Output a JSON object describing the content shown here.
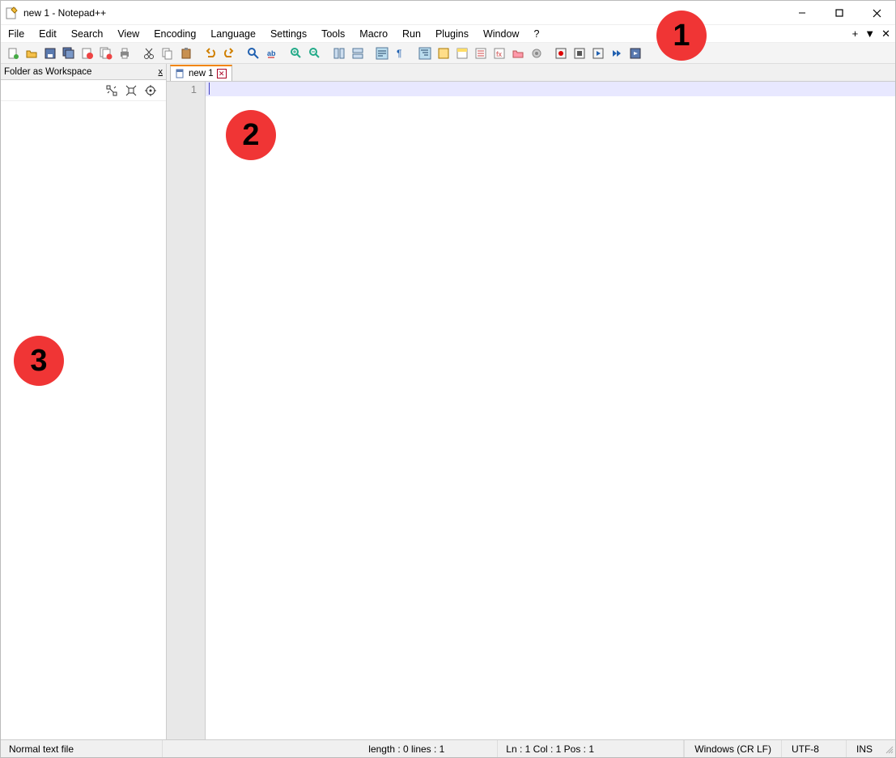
{
  "title": "new 1 - Notepad++",
  "menu": [
    "File",
    "Edit",
    "Search",
    "View",
    "Encoding",
    "Language",
    "Settings",
    "Tools",
    "Macro",
    "Run",
    "Plugins",
    "Window",
    "?"
  ],
  "toolbar_names": [
    "new",
    "open",
    "save",
    "save-all",
    "close",
    "close-all",
    "print",
    "",
    "cut",
    "copy",
    "paste",
    "",
    "undo",
    "redo",
    "",
    "find",
    "replace",
    "",
    "zoom-in",
    "zoom-out",
    "",
    "sync-v",
    "sync-h",
    "",
    "word-wrap",
    "all-chars",
    "indent-guide",
    "",
    "doc-map",
    "func-list",
    "folder-ws",
    "monitor",
    "",
    "record",
    "stop",
    "play",
    "play-multi",
    "save-macro"
  ],
  "sidebar": {
    "title": "Folder as Workspace"
  },
  "tab": {
    "label": "new 1"
  },
  "gutter_line": "1",
  "status": {
    "filetype": "Normal text file",
    "length_lines": "length : 0    lines : 1",
    "pos": "Ln : 1    Col : 1    Pos : 1",
    "eol": "Windows (CR LF)",
    "encoding": "UTF-8",
    "mode": "INS"
  },
  "badges": {
    "b1": "1",
    "b2": "2",
    "b3": "3"
  }
}
